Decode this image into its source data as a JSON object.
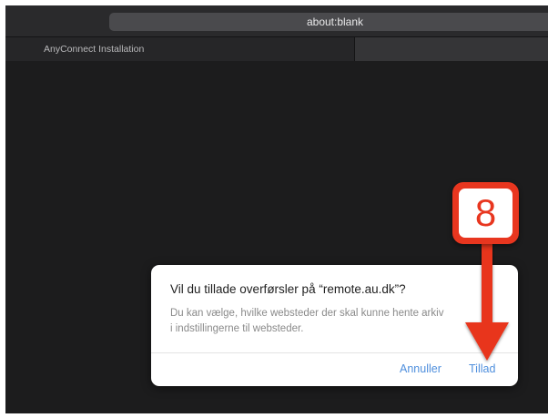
{
  "toolbar": {
    "address": "about:blank"
  },
  "tabs": [
    {
      "label": "AnyConnect Installation"
    }
  ],
  "dialog": {
    "title": "Vil du tillade overførsler på “remote.au.dk”?",
    "message_line1": "Du kan vælge, hvilke websteder der skal kunne hente arkiv",
    "message_line2": "i indstillingerne til websteder.",
    "cancel_label": "Annuller",
    "allow_label": "Tillad"
  },
  "annotation": {
    "step_number": "8",
    "color": "#e8361f"
  },
  "colors": {
    "accent": "#4f8fdd",
    "window_bg": "#1c1c1d"
  }
}
